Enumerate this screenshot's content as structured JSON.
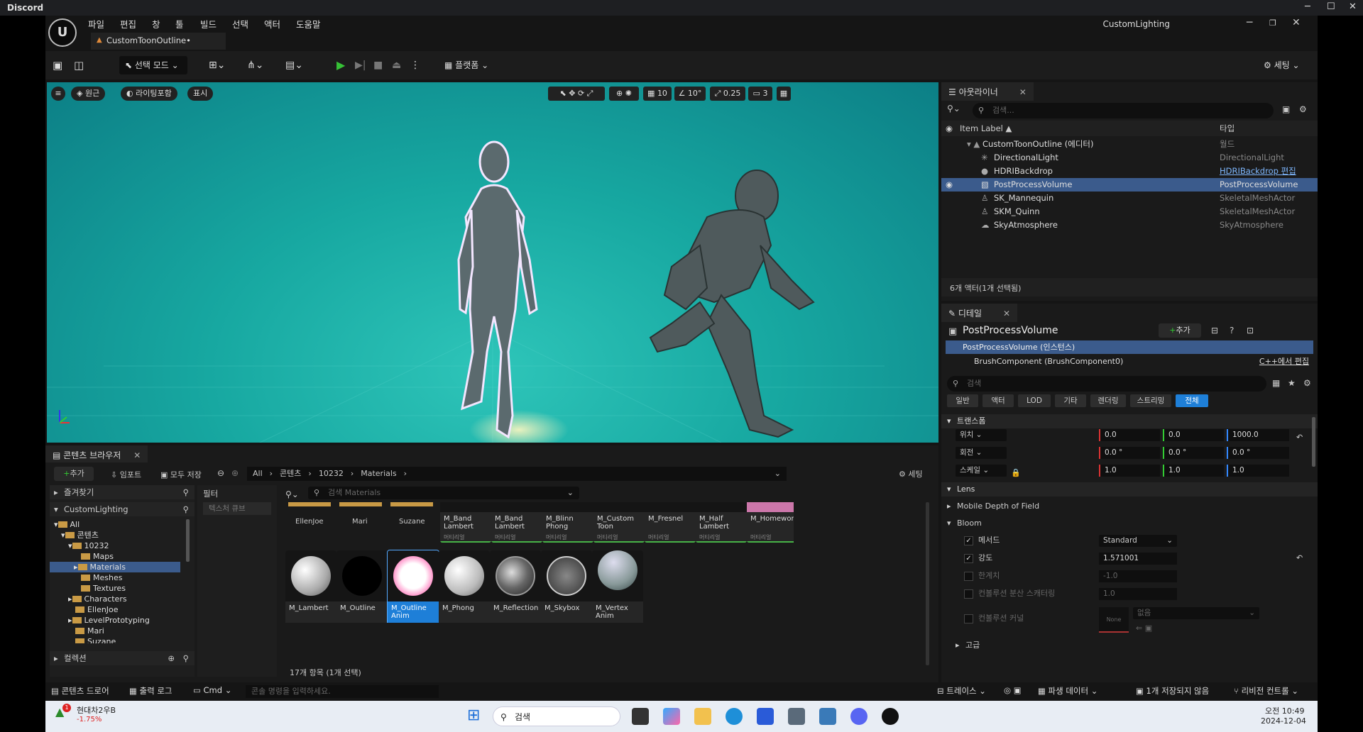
{
  "discord": {
    "title": "Discord",
    "min": "─",
    "max": "☐",
    "close": "✕"
  },
  "menu": [
    "파일",
    "편집",
    "창",
    "툴",
    "빌드",
    "선택",
    "액터",
    "도움말"
  ],
  "doc_tab": "CustomToonOutline•",
  "project": "CustomLighting",
  "toolbar": {
    "select_mode": "선택 모드",
    "platform": "플랫폼",
    "settings": "세팅"
  },
  "viewport": {
    "left_buttons": [
      "원근",
      "라이팅포함",
      "표시"
    ],
    "grid": "10",
    "rotate": "10°",
    "scale": "0.25",
    "cam": "3"
  },
  "outliner": {
    "tab": "아웃라이너",
    "search_placeholder": "검색...",
    "col_label": "Item Label ▲",
    "col_type": "타입",
    "status": "6개 액터(1개 선택됨)",
    "rows": [
      {
        "label": "CustomToonOutline (에디터)",
        "type": "월드"
      },
      {
        "label": "DirectionalLight",
        "type": "DirectionalLight"
      },
      {
        "label": "HDRIBackdrop",
        "type": "HDRIBackdrop 편집"
      },
      {
        "label": "PostProcessVolume",
        "type": "PostProcessVolume"
      },
      {
        "label": "SK_Mannequin",
        "type": "SkeletalMeshActor"
      },
      {
        "label": "SKM_Quinn",
        "type": "SkeletalMeshActor"
      },
      {
        "label": "SkyAtmosphere",
        "type": "SkyAtmosphere"
      }
    ]
  },
  "details": {
    "tab": "디테일",
    "object": "PostProcessVolume",
    "add": "추가",
    "instance": "PostProcessVolume (인스턴스)",
    "component": "BrushComponent (BrushComponent0)",
    "cpp": "C++에서 편집",
    "search_placeholder": "검색",
    "filters": [
      "일반",
      "액터",
      "LOD",
      "기타",
      "렌더링",
      "스트리밍",
      "전체"
    ],
    "transform": "트랜스폼",
    "loc_label": "위치",
    "loc": [
      "0.0",
      "0.0",
      "1000.0"
    ],
    "rot_label": "회전",
    "rot": [
      "0.0 °",
      "0.0 °",
      "0.0 °"
    ],
    "scale_label": "스케일",
    "scale": [
      "1.0",
      "1.0",
      "1.0"
    ],
    "lens": "Lens",
    "mobile_dof": "Mobile Depth of Field",
    "bloom": "Bloom",
    "method_label": "메서드",
    "method": "Standard",
    "intensity_label": "강도",
    "intensity": "1.571001",
    "threshold_label": "한계치",
    "threshold": "-1.0",
    "conv_scatter_label": "컨볼루션 분산 스캐터링",
    "conv_scatter": "1.0",
    "conv_kernel_label": "컨볼루션 커널",
    "kernel_none": "None",
    "kernel_value": "없음",
    "advanced": "고급"
  },
  "content": {
    "tab": "콘텐츠 브라우저",
    "add": "추가",
    "import": "임포트",
    "save_all": "모두 저장",
    "settings": "세팅",
    "path": [
      "All",
      "콘텐츠",
      "10232",
      "Materials"
    ],
    "favorites": "즐겨찾기",
    "project_root": "CustomLighting",
    "filter": "필터",
    "filter_item": "텍스처 큐브",
    "collections": "컬렉션",
    "search_placeholder": "검색 Materials",
    "tree": [
      "All",
      "콘텐츠",
      "10232",
      "Maps",
      "Materials",
      "Meshes",
      "Textures",
      "Characters",
      "EllenJoe",
      "LevelPrototyping",
      "Mari",
      "Suzane"
    ],
    "folders_top": [
      "EllenJoe",
      "Mari",
      "Suzane"
    ],
    "assets_top": [
      "M_Band Lambert",
      "M_Band Lambert",
      "M_Blinn Phong",
      "M_Custom Toon",
      "M_Fresnel",
      "M_Half Lambert",
      "M_Homework"
    ],
    "assets_bottom": [
      "M_Lambert",
      "M_Outline",
      "M_Outline Anim",
      "M_Phong",
      "M_Reflection",
      "M_Skybox",
      "M_Vertex Anim"
    ],
    "asset_tag": "머티리얼",
    "count": "17개 항목 (1개 선택)"
  },
  "statusbar": {
    "drawer": "콘텐츠 드로어",
    "output": "출력 로그",
    "cmd": "Cmd",
    "console_placeholder": "콘솔 명령을 입력하세요.",
    "trace": "트레이스",
    "derived": "파생 데이터",
    "unsaved": "1개 저장되지 않음",
    "revision": "리비전 컨트롤"
  },
  "taskbar": {
    "stock_name": "현대차2우B",
    "stock_change": "-1.75%",
    "search": "검색",
    "time": "오전 10:49",
    "date": "2024-12-04"
  }
}
